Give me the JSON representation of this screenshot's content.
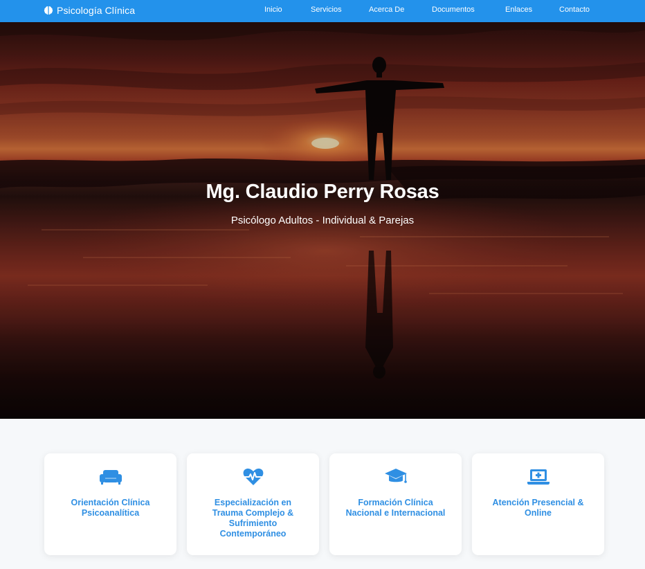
{
  "navbar": {
    "brand": "Psicología Clínica",
    "brand_icon": "brain-icon",
    "links": [
      "Inicio",
      "Servicios",
      "Acerca De",
      "Documentos",
      "Enlaces",
      "Contacto"
    ],
    "background_color": "#2392eb"
  },
  "hero": {
    "title": "Mg. Claudio Perry Rosas",
    "subtitle": "Psicólogo Adultos - Individual & Parejas"
  },
  "features": [
    {
      "icon": "couch-icon",
      "title": "Orientación Clínica Psicoanalítica"
    },
    {
      "icon": "heartbeat-icon",
      "title": "Especialización en Trauma Complejo & Sufrimiento Contemporáneo"
    },
    {
      "icon": "graduation-cap-icon",
      "title": "Formación Clínica Nacional e Internacional"
    },
    {
      "icon": "laptop-medical-icon",
      "title": "Atención Presencial & Online"
    }
  ],
  "accent_color": "#2f8fe3"
}
